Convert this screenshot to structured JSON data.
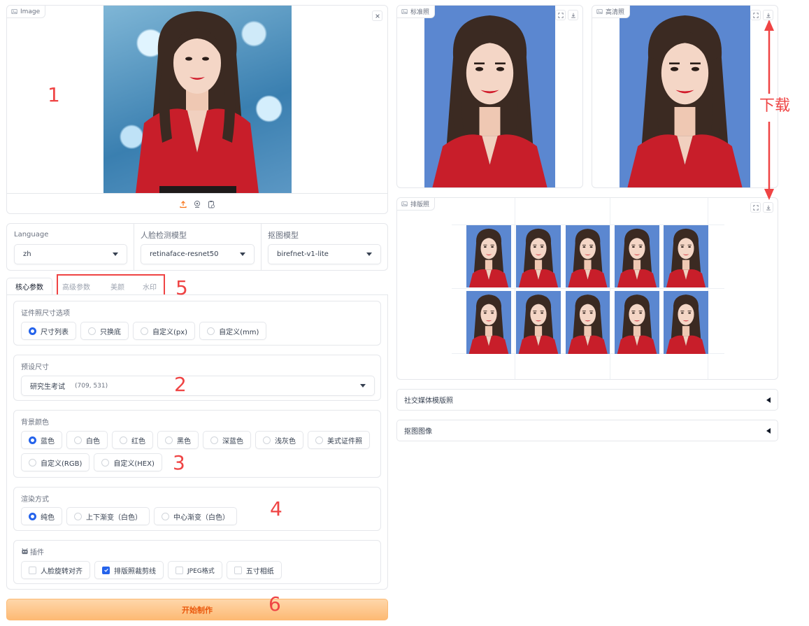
{
  "input_image": {
    "label": "Image"
  },
  "outputs": {
    "standard": {
      "label": "标准照"
    },
    "hd": {
      "label": "高清照"
    },
    "layout": {
      "label": "排版照"
    }
  },
  "settings": {
    "language": {
      "label": "Language",
      "value": "zh"
    },
    "face_model": {
      "label": "人脸检测模型",
      "value": "retinaface-resnet50"
    },
    "matting_model": {
      "label": "抠图模型",
      "value": "birefnet-v1-lite"
    }
  },
  "tabs": [
    {
      "label": "核心参数",
      "active": true
    },
    {
      "label": "高级参数",
      "active": false
    },
    {
      "label": "美颜",
      "active": false
    },
    {
      "label": "水印",
      "active": false
    }
  ],
  "size_options": {
    "label": "证件照尺寸选项",
    "options": [
      "尺寸列表",
      "只换底",
      "自定义(px)",
      "自定义(mm)"
    ],
    "selected": "尺寸列表"
  },
  "preset_size": {
    "label": "预设尺寸",
    "value": "研究生考试",
    "hint": "(709, 531)"
  },
  "background_color": {
    "label": "背景颜色",
    "options": [
      "蓝色",
      "白色",
      "红色",
      "黑色",
      "深蓝色",
      "浅灰色",
      "美式证件照",
      "自定义(RGB)",
      "自定义(HEX)"
    ],
    "selected": "蓝色"
  },
  "render_mode": {
    "label": "渲染方式",
    "options": [
      "纯色",
      "上下渐变（白色）",
      "中心渐变（白色）"
    ],
    "selected": "纯色"
  },
  "plugins": {
    "label": "插件",
    "options": [
      {
        "label": "人脸旋转对齐",
        "checked": false
      },
      {
        "label": "排版照裁剪线",
        "checked": true
      },
      {
        "label": "JPEG格式",
        "checked": false
      },
      {
        "label": "五寸相纸",
        "checked": false
      }
    ]
  },
  "accordions": {
    "social": "社交媒体模版照",
    "matting": "抠图图像"
  },
  "run_button": "开始制作",
  "annotations": {
    "n1": "1",
    "n2": "2",
    "n3": "3",
    "n4": "4",
    "n5": "5",
    "n6": "6",
    "download": "下载"
  },
  "colors": {
    "accent": "#2563eb",
    "id_bg": "#5b87d0",
    "annotation": "#ef4444",
    "run_text": "#ea580c"
  }
}
